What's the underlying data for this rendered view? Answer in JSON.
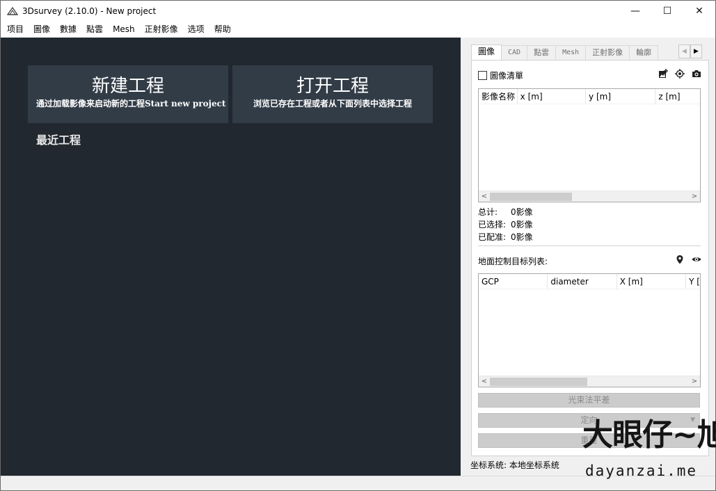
{
  "window": {
    "title": "3Dsurvey (2.10.0) - New project",
    "controls": {
      "minimize": "—",
      "maximize": "☐",
      "close": "✕"
    }
  },
  "menu": [
    "项目",
    "圖像",
    "數據",
    "點雲",
    "Mesh",
    "正射影像",
    "选项",
    "帮助"
  ],
  "start": {
    "new_project": {
      "title": "新建工程",
      "subtitle": "通过加载影像来启动新的工程Start new project by loading images"
    },
    "open_project": {
      "title": "打开工程",
      "subtitle": "浏览已存在工程或者从下面列表中选择工程"
    },
    "recent_title": "最近工程"
  },
  "tabs": [
    {
      "label": "圖像",
      "active": true
    },
    {
      "label": "CAD"
    },
    {
      "label": "點雲"
    },
    {
      "label": "Mesh"
    },
    {
      "label": "正射影像"
    },
    {
      "label": "輪廓"
    }
  ],
  "tab_scroll": {
    "left": "◀",
    "right": "▶"
  },
  "images_panel": {
    "checkbox_label": "圖像清單",
    "icons": [
      "add-image-icon",
      "locate-icon",
      "camera-icon"
    ],
    "columns": [
      "影像名称",
      "x [m]",
      "y [m]",
      "z [m]"
    ],
    "scroll_left": "<",
    "scroll_right": ">",
    "stats": [
      {
        "label": "总计:",
        "value": "0影像"
      },
      {
        "label": "已选择:",
        "value": "0影像"
      },
      {
        "label": "已配准:",
        "value": "0影像"
      }
    ]
  },
  "gcp_panel": {
    "label": "地面控制目标列表:",
    "icons": [
      "marker-icon",
      "eye-icon"
    ],
    "columns": [
      "GCP",
      "diameter",
      "X [m]",
      "Y [m]"
    ]
  },
  "buttons": {
    "bundle_adjust": "光束法平差",
    "orient": "定向",
    "orient_dropdown": "▼",
    "rebuild": "重建"
  },
  "coord_system": {
    "label": "坐标系统:",
    "value": "本地坐标系统"
  },
  "watermark": {
    "big": "大眼仔~旭",
    "small": "dayanzai.me"
  }
}
